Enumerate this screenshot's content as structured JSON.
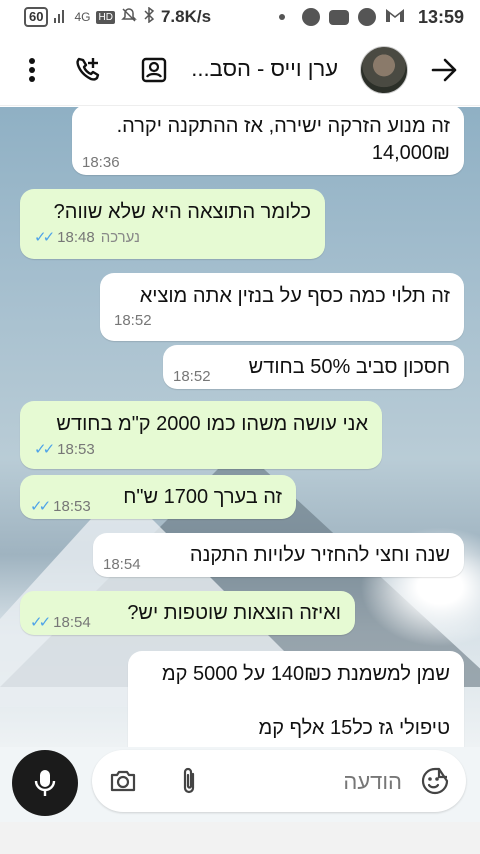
{
  "status_bar": {
    "battery": "60",
    "network": "4G",
    "hd": "HD",
    "speed": "7.8K/s",
    "time": "13:59"
  },
  "header": {
    "title": "ערן וייס - הסב...",
    "icons": [
      "kebab-menu-icon",
      "add-call-icon",
      "contact-card-icon",
      "back-arrow-icon"
    ]
  },
  "messages": [
    {
      "dir": "in",
      "text": "זה מנוע הזרקה ישירה, אז ההתקנה יקרה.\n14,000₪",
      "time": "18:36"
    },
    {
      "dir": "out",
      "text": "כלומר התוצאה היא שלא שווה?",
      "time": "18:48",
      "edited": "נערכה"
    },
    {
      "dir": "in",
      "text": "זה תלוי כמה כסף על בנזין אתה מוציא",
      "time": "18:52"
    },
    {
      "dir": "in",
      "text": "חסכון סביב 50% בחודש",
      "time": "18:52"
    },
    {
      "dir": "out",
      "text": "אני עושה משהו כמו 2000 ק\"מ בחודש",
      "time": "18:53"
    },
    {
      "dir": "out",
      "text": "זה בערך 1700 ש\"ח",
      "time": "18:53"
    },
    {
      "dir": "in",
      "text": "שנה וחצי להחזיר עלויות התקנה",
      "time": "18:54"
    },
    {
      "dir": "out",
      "text": "ואיזה הוצאות שוטפות יש?",
      "time": "18:54"
    },
    {
      "dir": "in",
      "text": "שמן למשמנת כ140₪ על 5000 קמ\n\nטיפולי גז כל15 אלף קמ",
      "time": ""
    }
  ],
  "composer": {
    "placeholder": "הודעה",
    "value": ""
  },
  "colors": {
    "incoming_bubble": "#ffffff",
    "outgoing_bubble": "#e6fad3",
    "read_ticks": "#4fa3e8",
    "mic_button": "#1b1b1b"
  }
}
